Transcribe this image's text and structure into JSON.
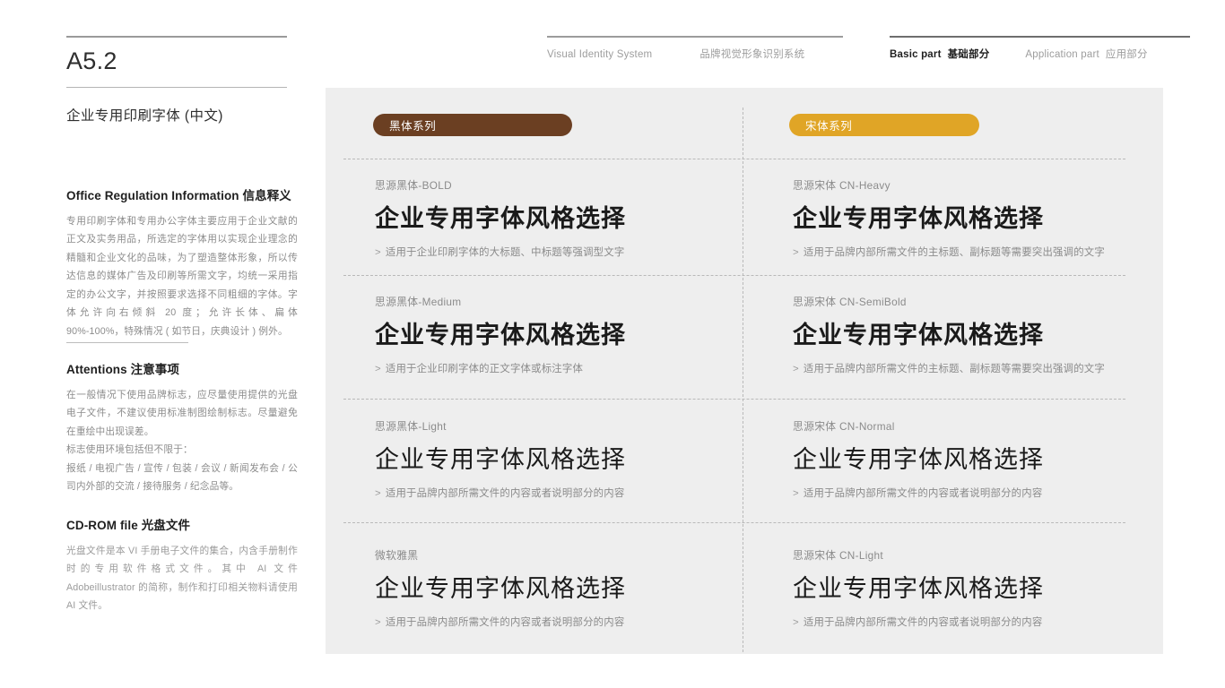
{
  "sidebar": {
    "code": "A5.2",
    "subtitle": "企业专用印刷字体 (中文)",
    "blocks": [
      {
        "heading": "Office Regulation Information 信息释义",
        "body": "专用印刷字体和专用办公字体主要应用于企业文献的正文及实务用品，所选定的字体用以实现企业理念的精髓和企业文化的品味，为了塑造整体形象，所以传达信息的媒体广告及印刷等所需文字，均统一采用指定的办公文字，并按照要求选择不同粗细的字体。字体允许向右倾斜 20 度；允许长体、扁体 90%-100%，特殊情况 ( 如节日，庆典设计 ) 例外。"
      },
      {
        "heading": "Attentions 注意事项",
        "body": "在一般情况下使用品牌标志，应尽量使用提供的光盘电子文件，不建议使用标准制图绘制标志。尽量避免在重绘中出现误差。",
        "body2": "标志使用环境包括但不限于：",
        "body3": "报纸 / 电视广告 / 宣传 / 包装 / 会议 / 新闻发布会 / 公司内外部的交流 / 接待服务 / 纪念品等。"
      },
      {
        "heading": "CD-ROM file 光盘文件",
        "body": "光盘文件是本 VI 手册电子文件的集合，内含手册制作时的专用软件格式文件。其中 AI 文件 Adobeillustrator 的简称，制作和打印相关物料请使用 AI 文件。"
      }
    ]
  },
  "header": {
    "left": {
      "en": "Visual Identity System",
      "cn": "品牌视觉形象识别系统"
    },
    "right": {
      "active_en": "Basic part",
      "active_cn": "基础部分",
      "inactive_en": "Application part",
      "inactive_cn": "应用部分"
    }
  },
  "panel": {
    "pills": [
      {
        "label": "黑体系列",
        "color": "#6B3F22"
      },
      {
        "label": "宋体系列",
        "color": "#E0A526"
      }
    ],
    "samples": {
      "left": [
        {
          "label": "思源黑体-BOLD",
          "sample": "企业专用字体风格选择",
          "note": "适用于企业印刷字体的大标题、中标题等强调型文字",
          "caret": ">"
        },
        {
          "label": "思源黑体-Medium",
          "sample": "企业专用字体风格选择",
          "note": "适用于企业印刷字体的正文字体或标注字体",
          "caret": ">"
        },
        {
          "label": "思源黑体-Light",
          "sample": "企业专用字体风格选择",
          "note": "适用于品牌内部所需文件的内容或者说明部分的内容",
          "caret": ">"
        },
        {
          "label": "微软雅黑",
          "sample": "企业专用字体风格选择",
          "note": "适用于品牌内部所需文件的内容或者说明部分的内容",
          "caret": ">"
        }
      ],
      "right": [
        {
          "label": "思源宋体 CN-Heavy",
          "sample": "企业专用字体风格选择",
          "note": "适用于品牌内部所需文件的主标题、副标题等需要突出强调的文字",
          "caret": ">"
        },
        {
          "label": "思源宋体 CN-SemiBold",
          "sample": "企业专用字体风格选择",
          "note": "适用于品牌内部所需文件的主标题、副标题等需要突出强调的文字",
          "caret": ">"
        },
        {
          "label": "思源宋体 CN-Normal",
          "sample": "企业专用字体风格选择",
          "note": "适用于品牌内部所需文件的内容或者说明部分的内容",
          "caret": ">"
        },
        {
          "label": "思源宋体 CN-Light",
          "sample": "企业专用字体风格选择",
          "note": "适用于品牌内部所需文件的内容或者说明部分的内容",
          "caret": ">"
        }
      ]
    }
  }
}
